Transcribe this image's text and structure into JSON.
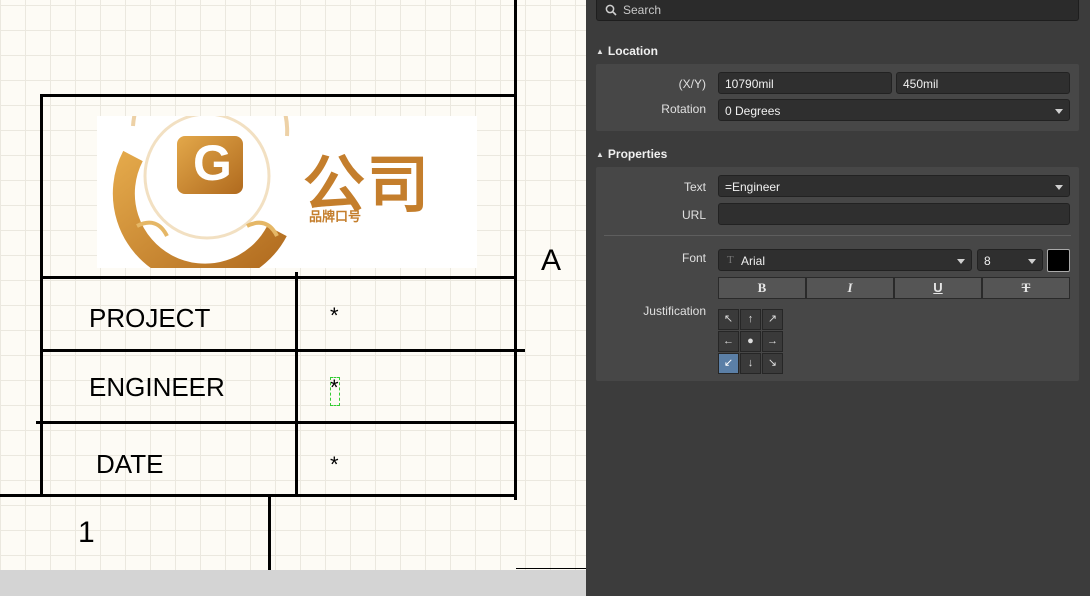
{
  "canvas": {
    "zone_letter": "A",
    "zone_number": "1",
    "rows": [
      {
        "label": "PROJECT",
        "value": "*"
      },
      {
        "label": "ENGINEER",
        "value": "*"
      },
      {
        "label": "DATE",
        "value": "*"
      }
    ],
    "logo": {
      "brand_text": "公司",
      "sub_text": "品牌口号",
      "mark_letter": "G"
    }
  },
  "panel": {
    "search_placeholder": "Search",
    "location": {
      "title": "Location",
      "xy_label": "(X/Y)",
      "x_value": "10790mil",
      "y_value": "450mil",
      "rotation_label": "Rotation",
      "rotation_value": "0 Degrees"
    },
    "properties": {
      "title": "Properties",
      "text_label": "Text",
      "text_value": "=Engineer",
      "url_label": "URL",
      "url_value": "",
      "font_label": "Font",
      "font_name": "Arial",
      "font_size": "8",
      "font_color": "#000000",
      "style_buttons": {
        "bold": "B",
        "italic": "I",
        "underline": "U",
        "strike": "T"
      },
      "justification_label": "Justification",
      "justification_grid": [
        "↖",
        "↑",
        "↗",
        "←",
        "●",
        "→",
        "↙",
        "↓",
        "↘"
      ],
      "justification_selected": "bottom-left"
    }
  },
  "colors": {
    "accent": "#5b7fa6",
    "logo_gold": "#c47e2c",
    "panel_bg": "#3c3c3c"
  }
}
